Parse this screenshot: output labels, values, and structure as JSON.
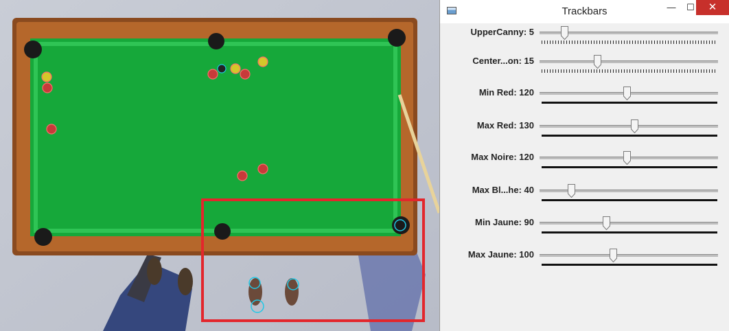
{
  "window": {
    "title": "Trackbars",
    "minimize_glyph": "—",
    "maximize_glyph": "☐",
    "close_glyph": "✕"
  },
  "trackbars": [
    {
      "label": "UpperCanny: 5",
      "value": 5,
      "fraction": 0.12,
      "style": "ticks"
    },
    {
      "label": "Center...on: 15",
      "value": 15,
      "fraction": 0.31,
      "style": "ticks"
    },
    {
      "label": "Min Red: 120",
      "value": 120,
      "fraction": 0.48,
      "style": "line"
    },
    {
      "label": "Max Red: 130",
      "value": 130,
      "fraction": 0.52,
      "style": "line"
    },
    {
      "label": "Max Noire: 120",
      "value": 120,
      "fraction": 0.48,
      "style": "line"
    },
    {
      "label": "Max Bl...he: 40",
      "value": 40,
      "fraction": 0.16,
      "style": "line"
    },
    {
      "label": "Min Jaune: 90",
      "value": 90,
      "fraction": 0.36,
      "style": "line"
    },
    {
      "label": "Max Jaune: 100",
      "value": 100,
      "fraction": 0.4,
      "style": "line"
    }
  ],
  "colors": {
    "felt": "#16a83a",
    "rail": "#b5672b",
    "detection_rect": "#e3262c",
    "pocket_circle": "#21c8e6",
    "ball_circle": "#ff6b6b"
  }
}
